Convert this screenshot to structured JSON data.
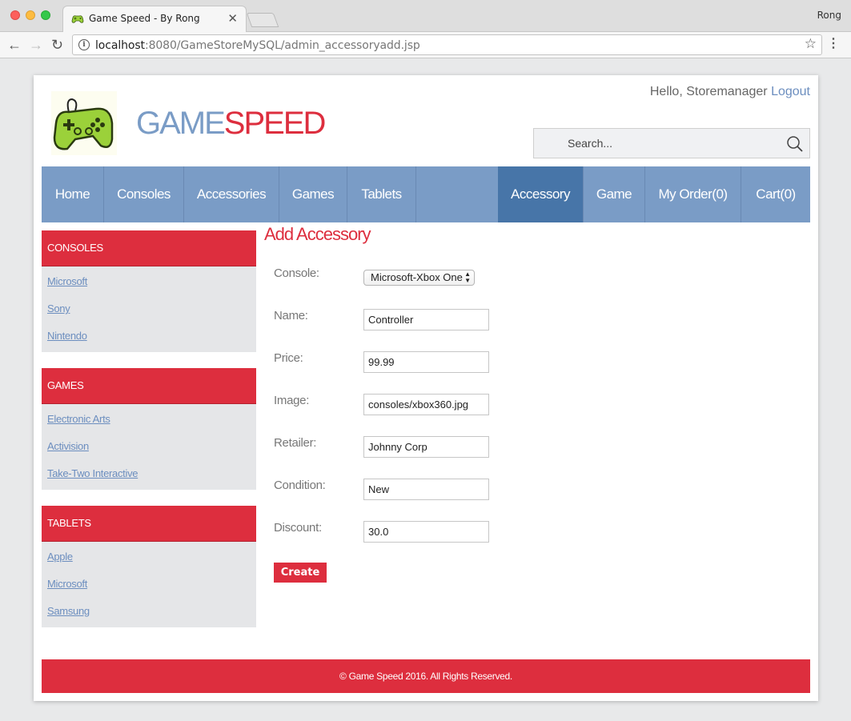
{
  "browser": {
    "tab_title": "Game Speed - By Rong",
    "profile_name": "Rong",
    "url_host": "localhost",
    "url_rest": ":8080/GameStoreMySQL/admin_accessoryadd.jsp"
  },
  "header": {
    "brand_part1": "GAME",
    "brand_part2": "SPEED",
    "greeting": "Hello, Storemanager",
    "logout_label": "Logout",
    "search_placeholder": "Search..."
  },
  "nav": {
    "left": [
      "Home",
      "Consoles",
      "Accessories",
      "Games",
      "Tablets"
    ],
    "right": [
      "Accessory",
      "Game",
      "My Order(0)",
      "Cart(0)"
    ],
    "active": "Accessory"
  },
  "sidebar": [
    {
      "title": "CONSOLES",
      "links": [
        "Microsoft",
        "Sony",
        "Nintendo"
      ]
    },
    {
      "title": "GAMES",
      "links": [
        "Electronic Arts",
        "Activision",
        "Take-Two Interactive"
      ]
    },
    {
      "title": "TABLETS",
      "links": [
        "Apple",
        "Microsoft",
        "Samsung"
      ]
    }
  ],
  "form": {
    "title": "Add Accessory",
    "console_label": "Console:",
    "console_value": "Microsoft-Xbox One",
    "fields": [
      {
        "label": "Name:",
        "value": "Controller"
      },
      {
        "label": "Price:",
        "value": "99.99"
      },
      {
        "label": "Image:",
        "value": "consoles/xbox360.jpg"
      },
      {
        "label": "Retailer:",
        "value": "Johnny Corp"
      },
      {
        "label": "Condition:",
        "value": "New"
      },
      {
        "label": "Discount:",
        "value": "30.0"
      }
    ],
    "submit_label": "Create"
  },
  "footer": {
    "text": "© Game Speed 2016. All Rights Reserved."
  },
  "colors": {
    "brand_blue": "#7a9cc6",
    "brand_red": "#dd2e3e",
    "active_nav": "#4775a8"
  }
}
